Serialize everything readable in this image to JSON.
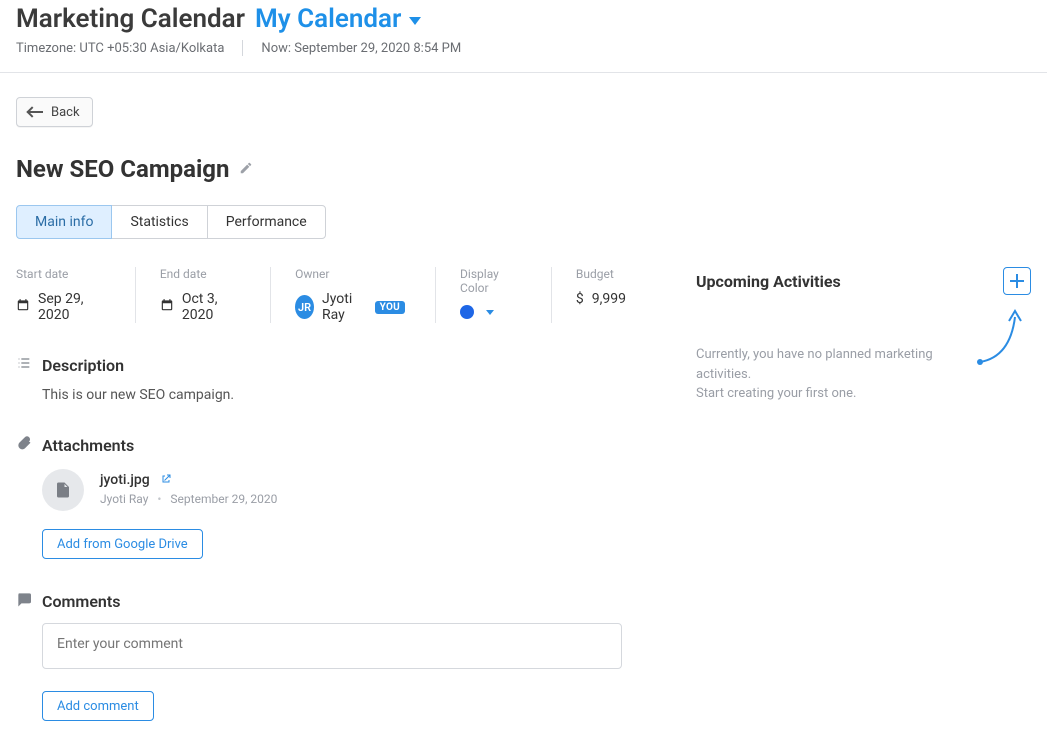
{
  "header": {
    "app_title": "Marketing Calendar",
    "calendar_name": "My Calendar",
    "timezone_label": "Timezone: UTC +05:30 Asia/Kolkata",
    "now_label": "Now: September 29, 2020 8:54 PM"
  },
  "back_button": "Back",
  "campaign": {
    "title": "New SEO Campaign"
  },
  "tabs": [
    {
      "label": "Main info",
      "active": true
    },
    {
      "label": "Statistics",
      "active": false
    },
    {
      "label": "Performance",
      "active": false
    }
  ],
  "info": {
    "start_date": {
      "label": "Start date",
      "value": "Sep 29, 2020"
    },
    "end_date": {
      "label": "End date",
      "value": "Oct 3, 2020"
    },
    "owner": {
      "label": "Owner",
      "initials": "JR",
      "name": "Jyoti Ray",
      "you_badge": "YOU"
    },
    "display_color": {
      "label": "Display Color",
      "hex": "#1e66e6"
    },
    "budget": {
      "label": "Budget",
      "currency": "$",
      "value": "9,999"
    }
  },
  "sections": {
    "description": {
      "title": "Description",
      "body": "This is our new SEO campaign."
    },
    "attachments": {
      "title": "Attachments",
      "files": [
        {
          "name": "jyoti.jpg",
          "uploader": "Jyoti Ray",
          "date": "September 29, 2020"
        }
      ],
      "add_button": "Add from Google Drive"
    },
    "comments": {
      "title": "Comments",
      "placeholder": "Enter your comment",
      "add_button": "Add comment"
    }
  },
  "activities": {
    "title": "Upcoming Activities",
    "empty_l1": "Currently, you have no planned marketing activities.",
    "empty_l2": "Start creating your first one."
  }
}
